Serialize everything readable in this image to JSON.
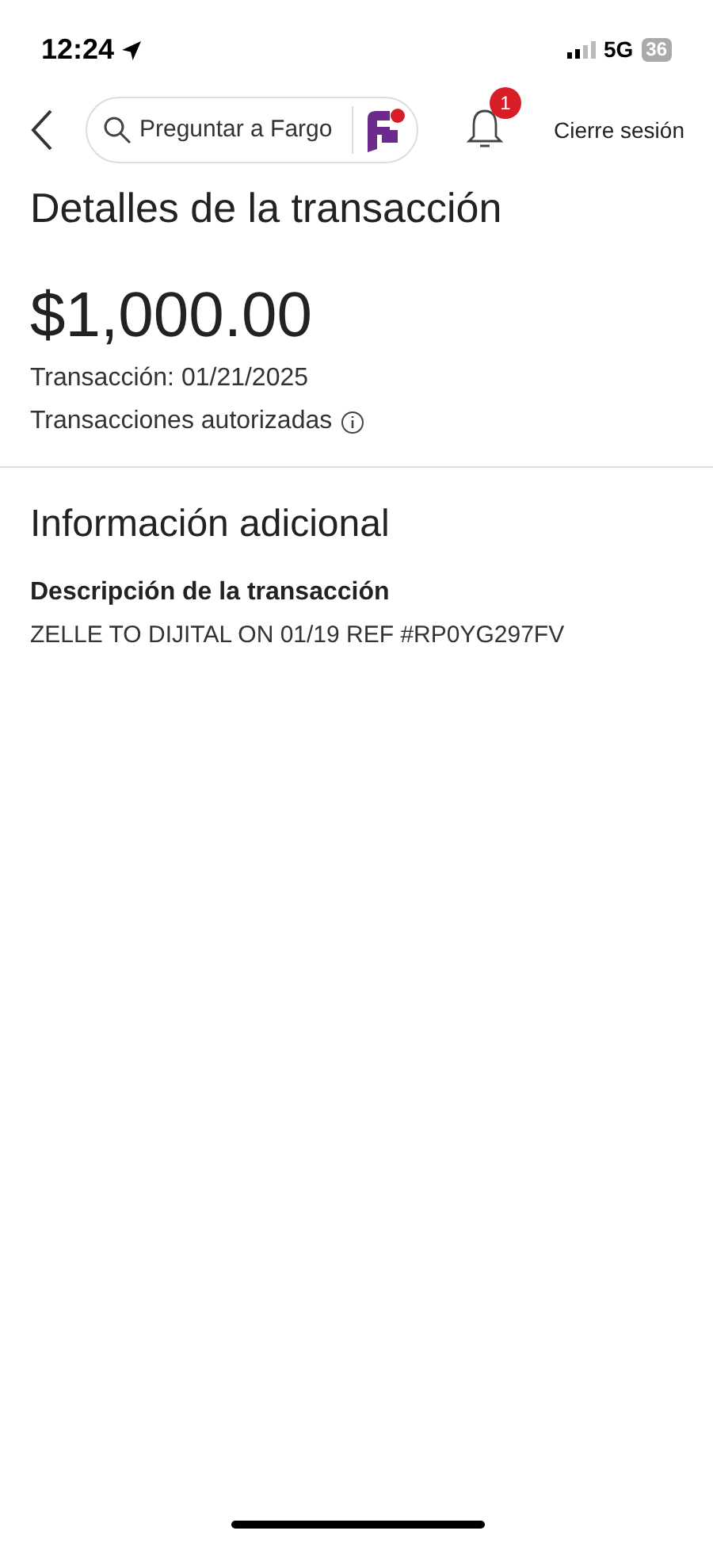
{
  "status_bar": {
    "time": "12:24",
    "network": "5G",
    "battery": "36"
  },
  "header": {
    "search": {
      "placeholder": "Preguntar a Fargo"
    },
    "notifications": {
      "count": "1"
    },
    "logout": "Cierre sesión"
  },
  "title": "Detalles de la transacción",
  "amount": "$1,000.00",
  "date": "Transacción: 01/21/2025",
  "status": "Transacciones autorizadas",
  "section": {
    "title": "Información adicional",
    "fields": [
      {
        "label": "Descripción de la transacción",
        "value": "ZELLE TO DIJITAL ON 01/19 REF #RP0YG297FV"
      }
    ]
  }
}
